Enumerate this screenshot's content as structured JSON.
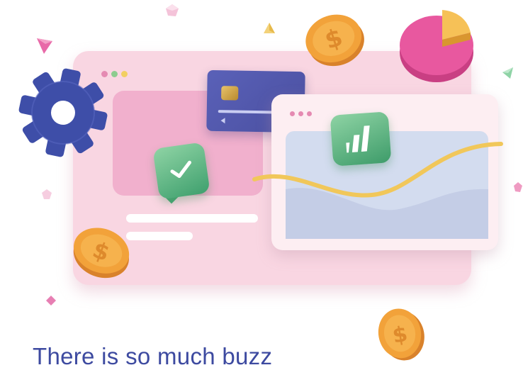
{
  "colors": {
    "window_pink": "#f9d6e2",
    "panel_pink": "#efa6c8",
    "chart_window": "#fdeef2",
    "chart_area": "#d3dcef",
    "card_blue": "#4f55a8",
    "gear_blue": "#3e4ea8",
    "badge_green": "#56b27f",
    "coin_orange": "#f2a23a",
    "pie_pink": "#e8589f",
    "pie_yellow": "#f6c157",
    "wave_yellow": "#f1c75a",
    "dot_pink": "#e58ab2",
    "dot_green": "#8ccc8f",
    "dot_yellow": "#f2cf62",
    "heading_blue": "#3d4aa0"
  },
  "icons": {
    "gear": "gear-icon",
    "card": "credit-card-icon",
    "check": "checkmark-icon",
    "bars": "bar-chart-icon",
    "coin": "dollar-coin-icon",
    "pie": "pie-chart-icon",
    "gem": "gem-icon",
    "wave": "trend-wave-icon"
  },
  "coins": [
    {
      "symbol": "$"
    },
    {
      "symbol": "$"
    },
    {
      "symbol": "$"
    }
  ],
  "caption": {
    "text": "There is so much buzz"
  }
}
